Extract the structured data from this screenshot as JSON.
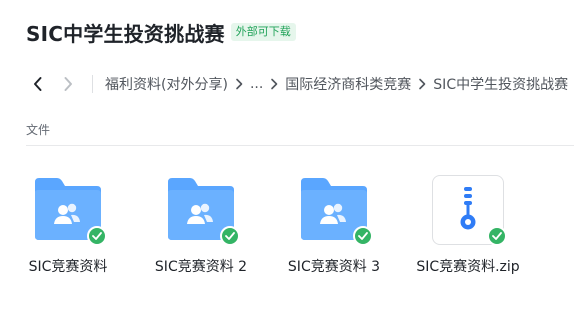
{
  "header": {
    "title": "SIC中学生投资挑战赛",
    "badge": "外部可下载"
  },
  "nav": {
    "back_icon": "chevron-left-icon",
    "forward_icon": "chevron-right-icon",
    "breadcrumbs": [
      {
        "label": "福利资料(对外分享)"
      },
      {
        "label": "..."
      },
      {
        "label": "国际经济商科类竞赛"
      },
      {
        "label": "SIC中学生投资挑战赛"
      }
    ]
  },
  "section": {
    "label": "文件"
  },
  "files": [
    {
      "name": "SIC竞赛资料",
      "type": "folder",
      "icon": "shared-folder-icon",
      "synced": true
    },
    {
      "name": "SIC竞赛资料 2",
      "type": "folder",
      "icon": "shared-folder-icon",
      "synced": true
    },
    {
      "name": "SIC竞赛资料 3",
      "type": "folder",
      "icon": "shared-folder-icon",
      "synced": true
    },
    {
      "name": "SIC竞赛资料.zip",
      "type": "zip",
      "icon": "zip-file-icon",
      "synced": true
    }
  ],
  "colors": {
    "folder": "#5aa6ff",
    "check": "#34b465",
    "badge_text": "#22a35a",
    "zip_icon": "#2f7cf6"
  }
}
